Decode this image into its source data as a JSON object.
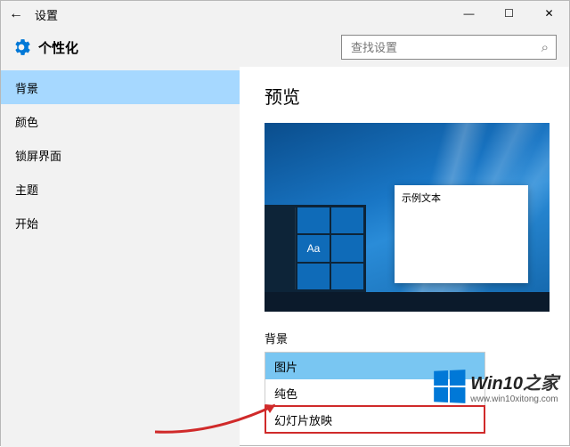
{
  "titlebar": {
    "title": "设置"
  },
  "header": {
    "page_title": "个性化"
  },
  "search": {
    "placeholder": "查找设置"
  },
  "sidebar": {
    "items": [
      {
        "label": "背景",
        "active": true
      },
      {
        "label": "颜色",
        "active": false
      },
      {
        "label": "锁屏界面",
        "active": false
      },
      {
        "label": "主题",
        "active": false
      },
      {
        "label": "开始",
        "active": false
      }
    ]
  },
  "main": {
    "preview_title": "预览",
    "sample_text": "示例文本",
    "tile_aa": "Aa",
    "bg_label": "背景",
    "dropdown": {
      "selected": "图片",
      "options": [
        "图片",
        "纯色",
        "幻灯片放映"
      ]
    }
  },
  "watermark": {
    "brand": "Win10",
    "suffix": "之家",
    "url": "www.win10xitong.com"
  },
  "icons": {
    "back": "←",
    "minimize": "—",
    "maximize": "☐",
    "close": "✕",
    "search": "⌕"
  }
}
